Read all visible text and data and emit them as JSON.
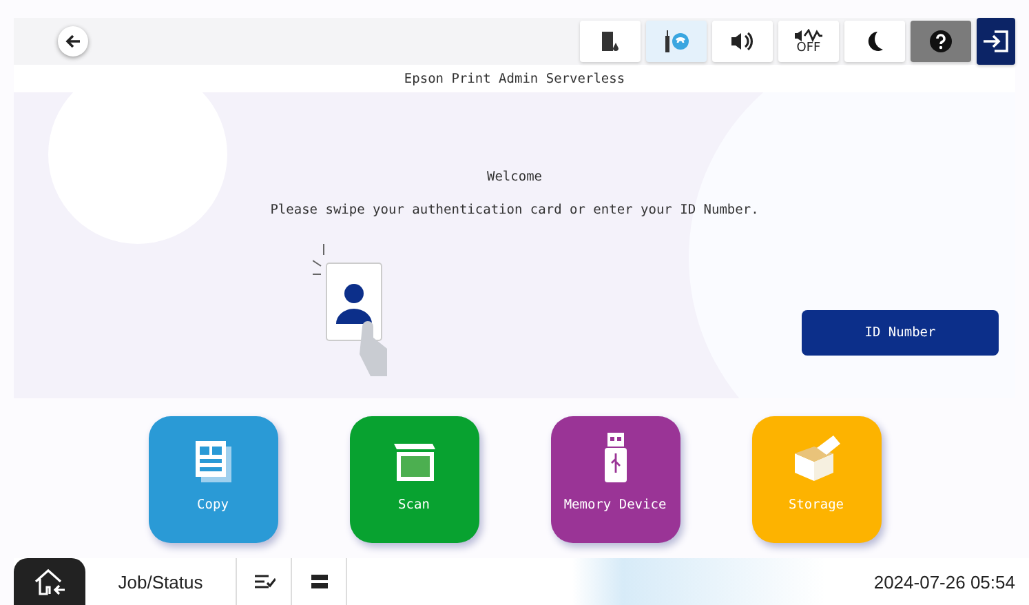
{
  "top_bar": {
    "status_icons": [
      {
        "kind": "ink",
        "highlighted": false
      },
      {
        "kind": "wifi",
        "highlighted": true
      },
      {
        "kind": "sound",
        "highlighted": false
      },
      {
        "kind": "quiet",
        "highlighted": false,
        "label": "OFF"
      },
      {
        "kind": "sleep",
        "highlighted": false
      },
      {
        "kind": "help",
        "highlighted": false
      },
      {
        "kind": "logout",
        "highlighted": false
      }
    ]
  },
  "title": "Epson Print Admin Serverless",
  "login": {
    "heading": "Welcome",
    "message": "Please swipe your authentication card or enter your ID Number.",
    "id_button": "ID Number"
  },
  "apps": [
    {
      "label": "Copy",
      "kind": "copy",
      "color": "#2a9ad6"
    },
    {
      "label": "Scan",
      "kind": "scan",
      "color": "#08a230"
    },
    {
      "label": "Memory Device",
      "kind": "memory",
      "color": "#9a3496"
    },
    {
      "label": "Storage",
      "kind": "storage",
      "color": "#fdb300"
    }
  ],
  "bottom_bar": {
    "job_status": "Job/Status",
    "datetime": "2024-07-26 05:54"
  }
}
